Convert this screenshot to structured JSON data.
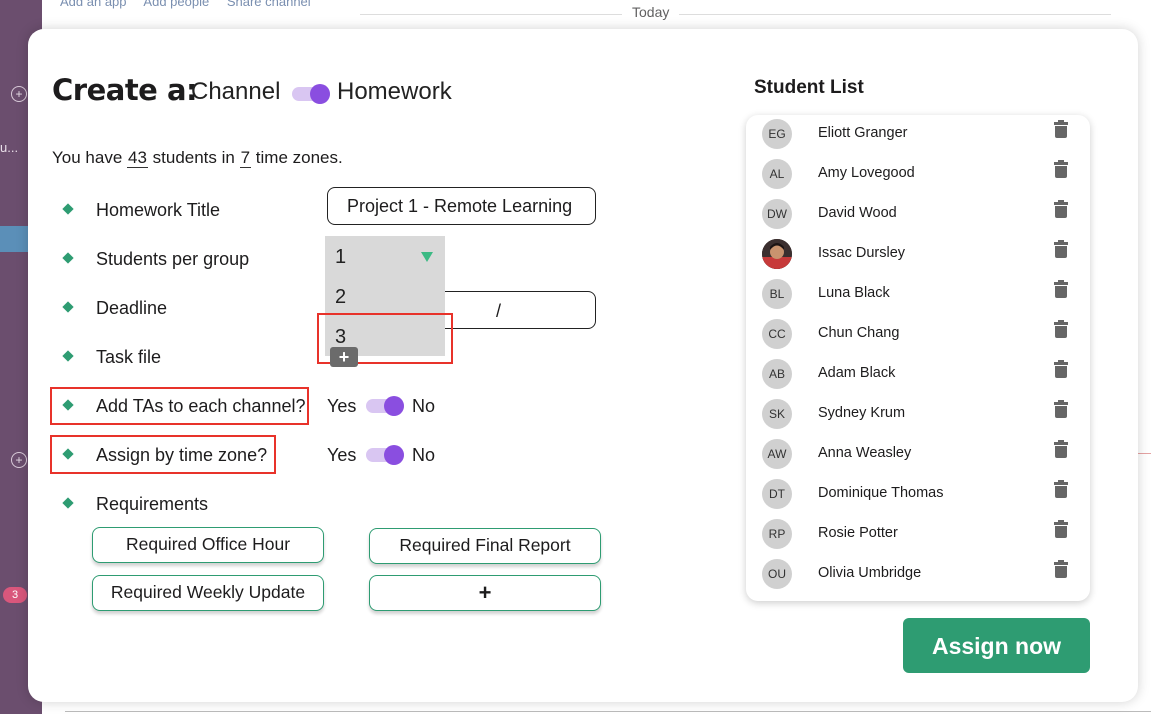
{
  "background": {
    "top_links": [
      "Add an app",
      "Add people",
      "Share channel"
    ],
    "date_divider": "Today",
    "sidebar_truncated": "u...",
    "sidebar_badge": "3"
  },
  "modal": {
    "create_label": "Create a:",
    "option_left": "Channel",
    "option_right": "Homework",
    "summary": {
      "prefix": "You have ",
      "student_count": "43",
      "mid": " students in ",
      "timezone_count": "7",
      "suffix": " time zones."
    },
    "fields": {
      "homework_title_label": "Homework Title",
      "homework_title_value": "Project 1 - Remote Learning",
      "students_per_group_label": "Students per group",
      "group_options": [
        "1",
        "2",
        "3"
      ],
      "deadline_label": "Deadline",
      "deadline_sep": "/",
      "task_file_label": "Task file",
      "task_file_add": "+",
      "add_tas_label": "Add TAs to each channel?",
      "assign_tz_label": "Assign by time zone?",
      "yes": "Yes",
      "no": "No",
      "requirements_label": "Requirements"
    },
    "requirements": [
      "Required Office Hour",
      "Required Final Report",
      "Required Weekly Update",
      "+"
    ],
    "student_list_title": "Student List",
    "students": [
      {
        "initials": "EG",
        "name": "Eliott Granger"
      },
      {
        "initials": "AL",
        "name": "Amy Lovegood"
      },
      {
        "initials": "DW",
        "name": "David Wood"
      },
      {
        "initials": "",
        "name": "Issac Dursley"
      },
      {
        "initials": "BL",
        "name": "Luna Black"
      },
      {
        "initials": "CC",
        "name": "Chun Chang"
      },
      {
        "initials": "AB",
        "name": "Adam Black"
      },
      {
        "initials": "SK",
        "name": "Sydney Krum"
      },
      {
        "initials": "AW",
        "name": "Anna Weasley"
      },
      {
        "initials": "DT",
        "name": "Dominique Thomas"
      },
      {
        "initials": "RP",
        "name": "Rosie Potter"
      },
      {
        "initials": "OU",
        "name": "Olivia Umbridge"
      }
    ],
    "assign_button": "Assign now"
  },
  "colors": {
    "accent_green": "#2e9c72",
    "toggle_purple": "#8a4ee0",
    "highlight_red": "#e8322a"
  }
}
